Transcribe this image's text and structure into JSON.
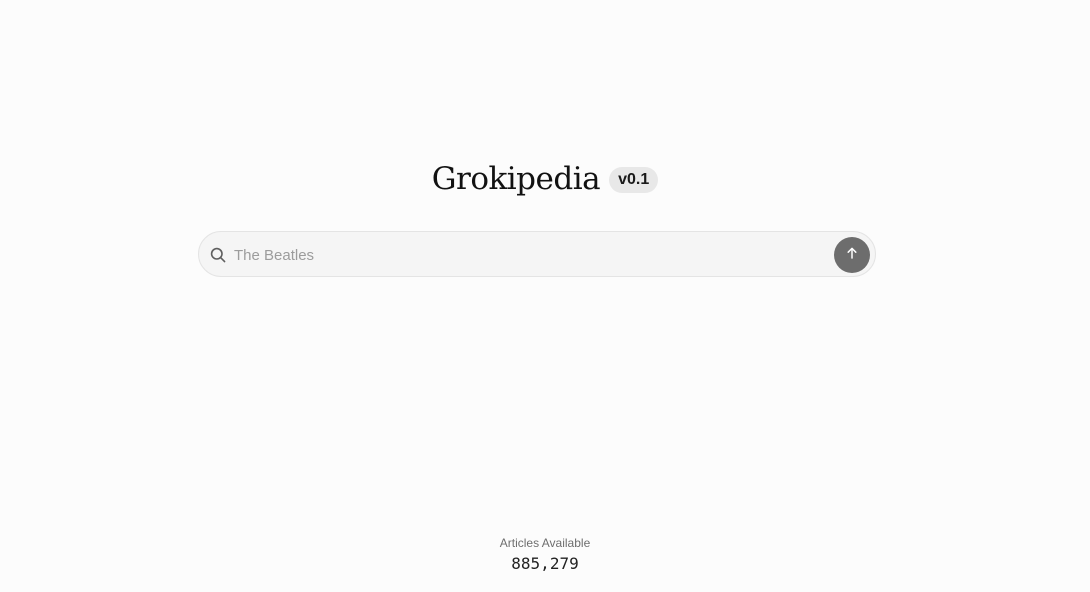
{
  "header": {
    "title": "Grokipedia",
    "version_badge": "v0.1"
  },
  "search": {
    "icon": "search-icon",
    "placeholder": "The Beatles",
    "value": "",
    "submit_icon": "arrow-up-icon"
  },
  "footer": {
    "articles_label": "Articles Available",
    "articles_count": "885,279"
  },
  "colors": {
    "background": "#fcfcfc",
    "badge_background": "#e8e8e8",
    "submit_button": "#6d6d6d"
  }
}
